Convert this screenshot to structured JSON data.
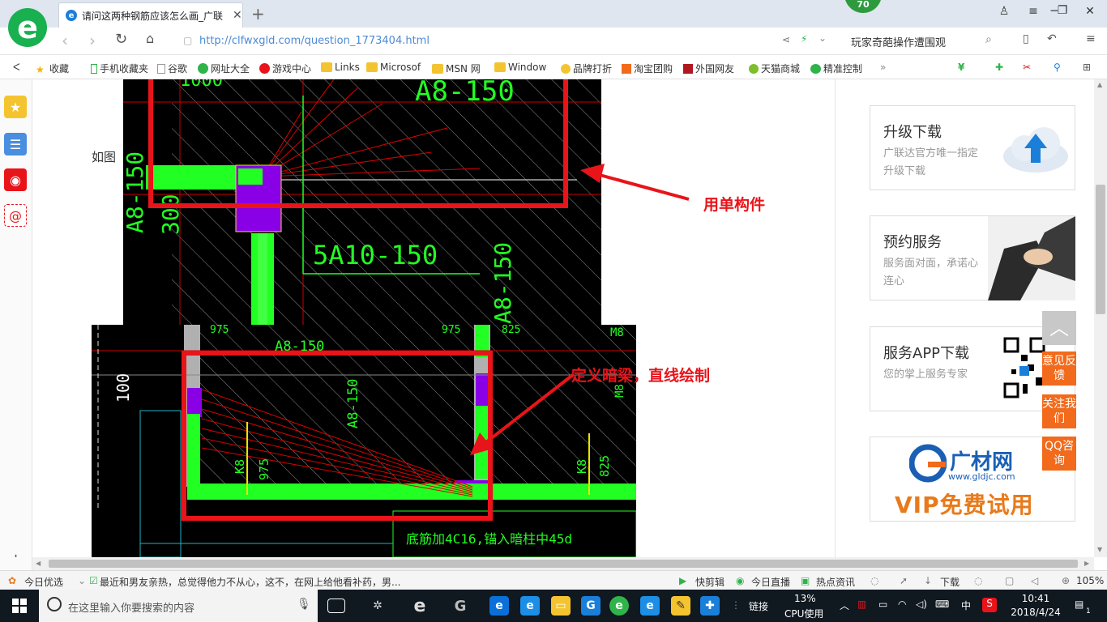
{
  "browser": {
    "tab_title": "请问这两种钢筋应该怎么画_广联",
    "tab_close": "✕",
    "new_tab": "+",
    "badge": "70",
    "url": "http://clfwxgld.com/question_1773404.html",
    "search_text": "玩家奇葩操作遭围观"
  },
  "bookmarks": [
    {
      "label": "收藏",
      "icon": "star-icon"
    },
    {
      "label": "手机收藏夹",
      "icon": "phone-icon"
    },
    {
      "label": "谷歌",
      "icon": "page-icon"
    },
    {
      "label": "网址大全",
      "icon": "globe-icon"
    },
    {
      "label": "游戏中心",
      "icon": "game-icon"
    },
    {
      "label": "Links",
      "icon": "folder-icon"
    },
    {
      "label": "Microsof",
      "icon": "folder-icon"
    },
    {
      "label": "MSN 网",
      "icon": "folder-icon"
    },
    {
      "label": "Window",
      "icon": "folder-icon"
    },
    {
      "label": "品牌打折",
      "icon": "tag-icon"
    },
    {
      "label": "淘宝团购",
      "icon": "taobao-icon"
    },
    {
      "label": "外国网友",
      "icon": "flag-icon"
    },
    {
      "label": "天猫商城",
      "icon": "tmall-icon"
    },
    {
      "label": "精准控制",
      "icon": "chat-icon"
    }
  ],
  "page": {
    "prefix_text": "如图",
    "annotation_1": "用单构件",
    "annotation_2": "定义暗梁，直线绘制"
  },
  "cad_top": {
    "labels": [
      "A8-150",
      "5A10-150",
      "A8-150",
      "A8-150",
      "300",
      "1000"
    ]
  },
  "cad_bottom": {
    "labels": [
      "100",
      "A8-150",
      "A8-150",
      "K8",
      "975",
      "K8",
      "825",
      "M8",
      "M8",
      "975",
      "975",
      "825",
      "底筋加4C16,锚入暗柱中45d"
    ]
  },
  "promos": [
    {
      "title": "升级下载",
      "sub": "广联达官方唯一指定升级下载"
    },
    {
      "title": "预约服务",
      "sub": "服务面对面，承诺心连心"
    },
    {
      "title": "服务APP下载",
      "sub": "您的掌上服务专家"
    },
    {
      "logo": "广材网",
      "domain": "www.gldjc.com",
      "vip": "VIP免费试用"
    }
  ],
  "floating_buttons": {
    "feedback": "意见反馈",
    "follow": "关注我们",
    "qq": "QQ咨询"
  },
  "statusbar": {
    "left": "今日优选",
    "news": "最近和男友亲热，总觉得他力不从心，这不，在网上给他看补药，男...",
    "quick_cut": "快剪辑",
    "live": "今日直播",
    "hot": "热点资讯",
    "download": "下载",
    "zoom": "105%"
  },
  "taskbar": {
    "search_placeholder": "在这里输入你要搜索的内容",
    "link": "链接",
    "cpu_percent": "13%",
    "cpu_label": "CPU使用",
    "ime": "中",
    "time": "10:41",
    "date": "2018/4/24",
    "notif_count": "1"
  },
  "colors": {
    "cad_bg": "#000000",
    "rebar_green": "#22ff22",
    "column_purple": "#8a00e6",
    "red": "#e8141a",
    "orange": "#f26a1b"
  }
}
